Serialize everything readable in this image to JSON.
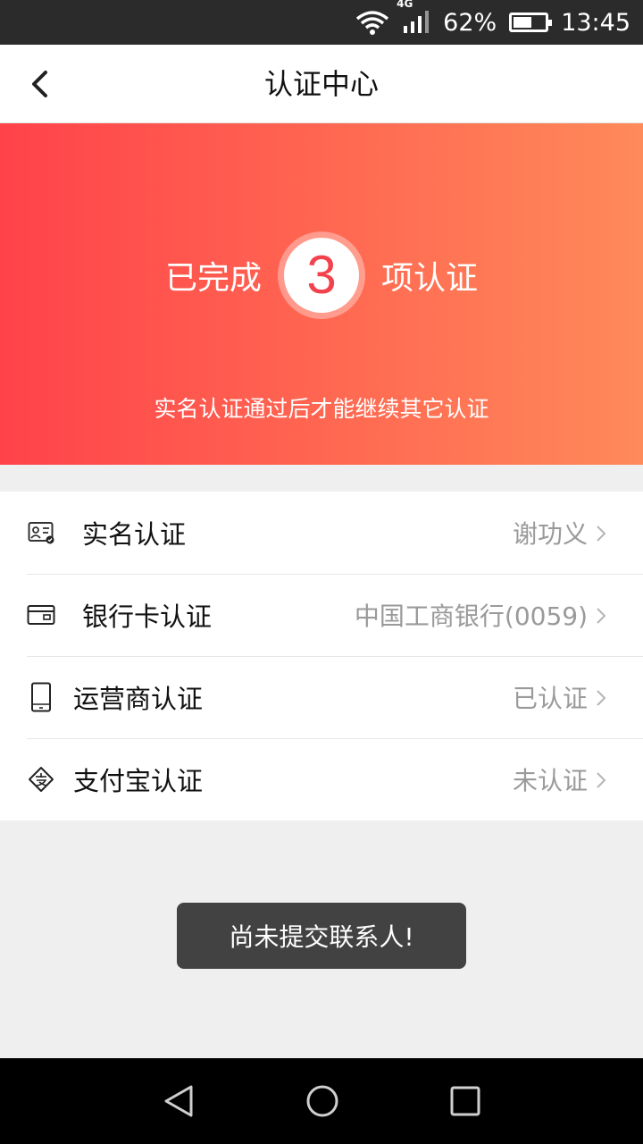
{
  "status_bar": {
    "network_type": "4G",
    "battery_text": "62%",
    "battery_level": 0.62,
    "time": "13:45"
  },
  "nav": {
    "title": "认证中心"
  },
  "banner": {
    "prefix": "已完成",
    "count": "3",
    "suffix": "项认证",
    "hint": "实名认证通过后才能继续其它认证",
    "colors": {
      "start": "#ff424a",
      "end": "#ff8a5a"
    }
  },
  "cert_list": [
    {
      "label": "实名认证",
      "value": "谢功义",
      "icon": "id-card-icon"
    },
    {
      "label": "银行卡认证",
      "value": "中国工商银行(0059)",
      "icon": "bank-card-icon"
    },
    {
      "label": "运营商认证",
      "value": "已认证",
      "icon": "phone-icon"
    },
    {
      "label": "支付宝认证",
      "value": "未认证",
      "icon": "alipay-icon"
    }
  ],
  "toast": {
    "message": "尚未提交联系人!"
  }
}
